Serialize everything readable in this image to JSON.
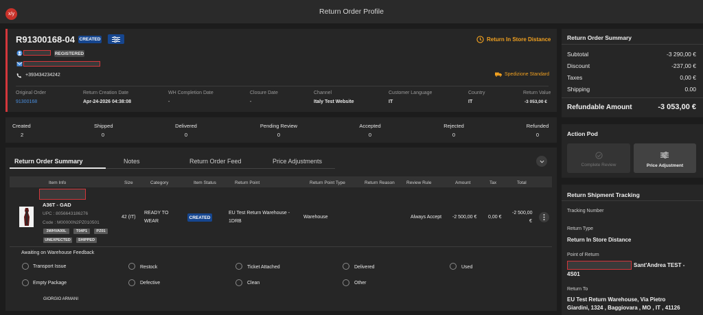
{
  "app": {
    "logo_text": "x/y",
    "title": "Return Order Profile"
  },
  "order": {
    "id": "R91300168-04",
    "status_badge": "CREATED",
    "registered_badge": "REGISTERED",
    "phone": "+393434234242",
    "return_type_link": "Return In Store Distance",
    "shipping_method": "Spedizione Standard",
    "info_columns": [
      {
        "label": "Original Order",
        "value": "91300168"
      },
      {
        "label": "Return Creation Date",
        "value": "Apr-24-2026 04:38:08"
      },
      {
        "label": "WH Completion Date",
        "value": "-"
      },
      {
        "label": "Closure Date",
        "value": "-"
      },
      {
        "label": "Channel",
        "value": "Italy Test Website"
      },
      {
        "label": "Customer Language",
        "value": "IT"
      },
      {
        "label": "Country",
        "value": "IT"
      },
      {
        "label": "Return Value",
        "value": "-3 053,00 €"
      }
    ]
  },
  "counts": [
    {
      "label": "Created",
      "value": "2"
    },
    {
      "label": "Shipped",
      "value": "0"
    },
    {
      "label": "Delivered",
      "value": "0"
    },
    {
      "label": "Pending Review",
      "value": "0"
    },
    {
      "label": "Accepted",
      "value": "0"
    },
    {
      "label": "Rejected",
      "value": "0"
    },
    {
      "label": "Refunded",
      "value": "0"
    }
  ],
  "tabs": [
    "Return Order Summary",
    "Notes",
    "Return Order Feed",
    "Price Adjustments"
  ],
  "table": {
    "headers": [
      "Item Info",
      "Size",
      "Category",
      "Item Status",
      "Return Point",
      "Return Point Type",
      "Return Reason",
      "Review Rule",
      "Amount",
      "Tax",
      "Total"
    ],
    "row": {
      "name": "A36T - GAD",
      "upc": "UPC : 8056643186276",
      "code": "Code : M00000N2PZ010501",
      "tags": [
        "3WHVA00L",
        "T04P1",
        "PZ01"
      ],
      "flags": [
        "UNEXPECTED",
        "SHIPPED"
      ],
      "size": "42 (IT)",
      "category_line1": "READY TO",
      "category_line2": "WEAR",
      "status": "CREATED",
      "return_point_line1": "EU Test Return Warehouse -",
      "return_point_line2": "1DRB",
      "return_point_type": "Warehouse",
      "return_reason": "",
      "review_rule": "Always Accept",
      "amount": "-2 500,00 €",
      "tax": "0,00 €",
      "total_line1": "-2 500,00",
      "total_line2": "€"
    }
  },
  "feedback": {
    "title": "Awaiting on Warehouse Feedback",
    "options_row1": [
      "Transport Issue",
      "Restock",
      "Ticket Attached",
      "Delivered",
      "Used"
    ],
    "options_row2": [
      "Empty Package",
      "Defective",
      "Clean",
      "Other"
    ],
    "brand": "GIORGIO ARMANI"
  },
  "summary": {
    "title": "Return Order Summary",
    "rows": [
      {
        "label": "Subtotal",
        "value": "-3 290,00 €"
      },
      {
        "label": "Discount",
        "value": "-237,00 €"
      },
      {
        "label": "Taxes",
        "value": "0,00 €"
      },
      {
        "label": "Shipping",
        "value": "0.00"
      }
    ],
    "refundable_label": "Refundable Amount",
    "refundable_value": "-3 053,00 €"
  },
  "action_pod": {
    "title": "Action Pod",
    "complete_review": "Complete Review",
    "price_adjustment": "Price Adjustment"
  },
  "tracking": {
    "title": "Return Shipment Tracking",
    "tracking_number_label": "Tracking Number",
    "return_type_label": "Return Type",
    "return_type_value": "Return In Store Distance",
    "point_of_return_label": "Point of Return",
    "point_of_return_suffix": "Sant'Andrea TEST -",
    "point_of_return_line2": "4S01",
    "return_to_label": "Return To",
    "return_to_line1": "EU Test Return Warehouse, Via Pietro",
    "return_to_line2": "Giardini, 1324 , Baggiovara , MO , IT , 41126"
  },
  "colors": {
    "accent_red": "#d4373b",
    "badge_blue": "#16468f",
    "link_blue": "#4a90e2",
    "warning_orange": "#f0a020"
  }
}
